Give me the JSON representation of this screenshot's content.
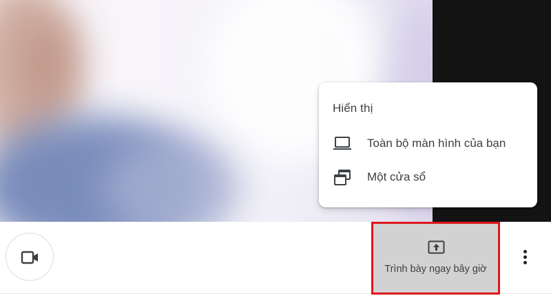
{
  "menu": {
    "title": "Hiển thị",
    "items": [
      {
        "label": "Toàn bộ màn hình của bạn",
        "icon": "laptop-icon"
      },
      {
        "label": "Một cửa sổ",
        "icon": "window-icon"
      }
    ]
  },
  "controls": {
    "camera_icon": "video-camera-icon",
    "present_label": "Trình bày ngay bây giờ",
    "present_icon": "present-screen-icon",
    "more_icon": "more-vert-icon"
  },
  "colors": {
    "highlight_border": "#e0161b",
    "present_bg": "#d2d2d2",
    "text": "#3c4043"
  }
}
